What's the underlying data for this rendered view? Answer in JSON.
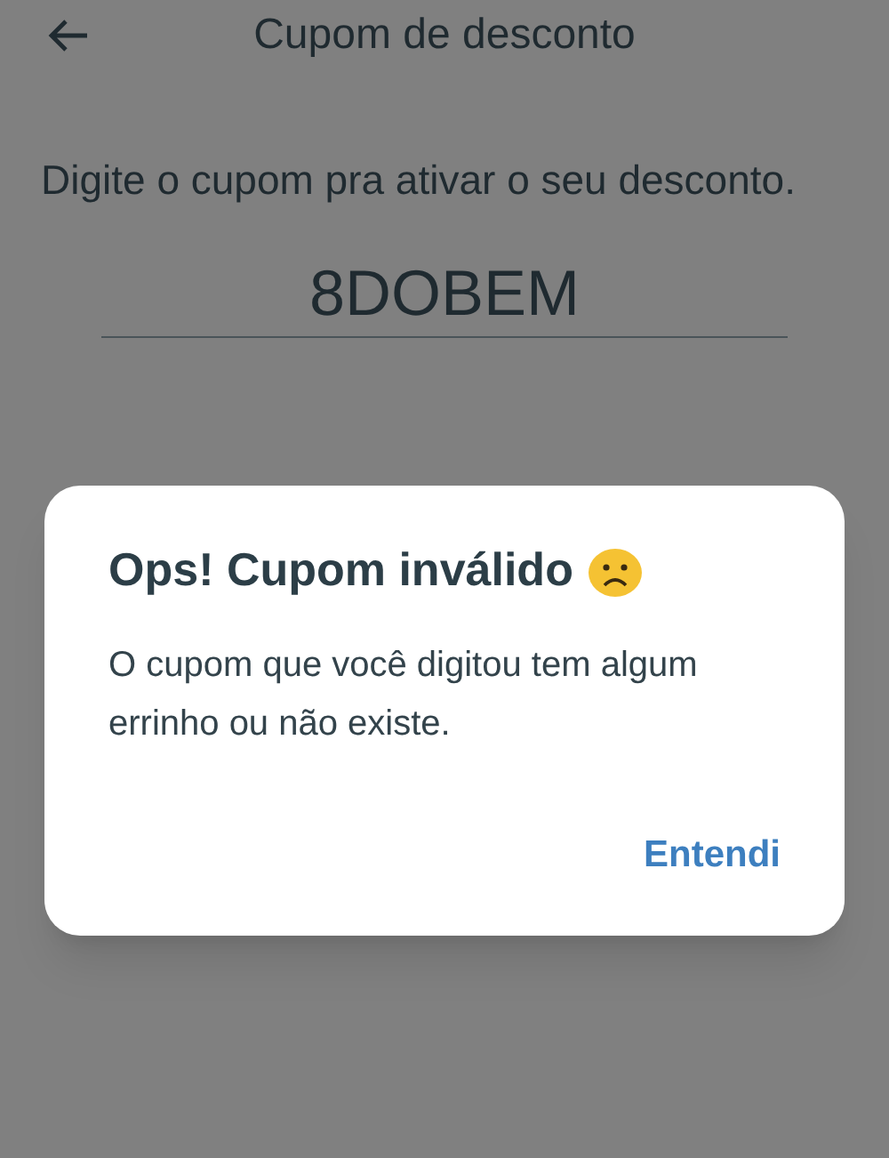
{
  "header": {
    "title": "Cupom de desconto"
  },
  "prompt": "Digite o cupom pra ativar o seu desconto.",
  "coupon_field": {
    "value": "8DOBEM"
  },
  "dialog": {
    "title": "Ops! Cupom inválido",
    "message": "O cupom que você digitou tem algum errinho ou não existe.",
    "buttons": [
      "Entendi"
    ]
  }
}
